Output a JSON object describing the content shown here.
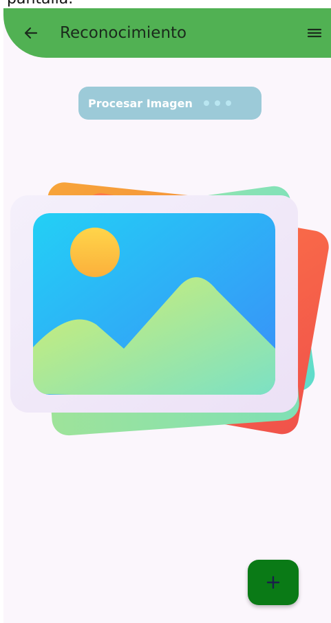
{
  "caption": "pantalla.",
  "appbar": {
    "title": "Reconocimiento",
    "back_icon": "arrow-left-icon",
    "menu_icon": "hamburger-menu-icon",
    "color": "#51b153"
  },
  "process_button": {
    "label": "Procesar Imagen",
    "loading_indicator": "dots-icon"
  },
  "placeholder_image": {
    "icon": "image-gallery-icon"
  },
  "fab": {
    "label": "+",
    "color": "#0a7a16"
  }
}
